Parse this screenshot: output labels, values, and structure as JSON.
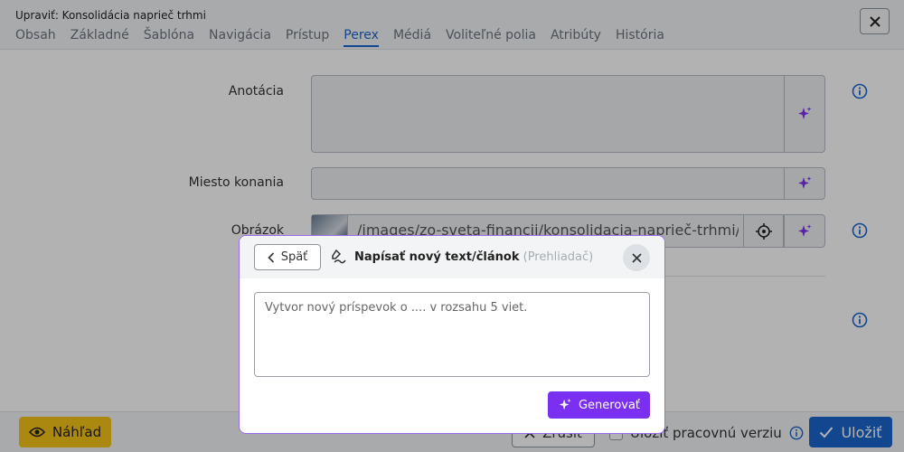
{
  "window": {
    "title": "Upraviť: Konsolidácia naprieč trhmi"
  },
  "tabs": [
    {
      "label": "Obsah"
    },
    {
      "label": "Základné"
    },
    {
      "label": "Šablóna"
    },
    {
      "label": "Navigácia"
    },
    {
      "label": "Prístup"
    },
    {
      "label": "Perex",
      "active": true
    },
    {
      "label": "Médiá"
    },
    {
      "label": "Voliteľné polia"
    },
    {
      "label": "Atribúty"
    },
    {
      "label": "História"
    }
  ],
  "form": {
    "annotation_label": "Anotácia",
    "venue_label": "Miesto konania",
    "image_label": "Obrázok",
    "image_path": "/images/zo-sveta-financii/konsolidacia-naprieč-trhmi/oil-p"
  },
  "footer": {
    "preview_label": "Náhľad",
    "cancel_label": "Zrušiť",
    "save_draft_label": "Uložiť pracovnú verziu",
    "save_label": "Uložiť"
  },
  "modal": {
    "back_label": "Späť",
    "title": "Napísať nový text/článok",
    "subtitle": "(Prehliadač)",
    "prompt_placeholder": "Vytvor nový príspevok o .... v rozsahu 5 viet.",
    "generate_label": "Generovať"
  },
  "colors": {
    "accent_blue": "#1a66cf",
    "ai_purple": "#7b2ff0",
    "preview_yellow": "#f5c518"
  }
}
